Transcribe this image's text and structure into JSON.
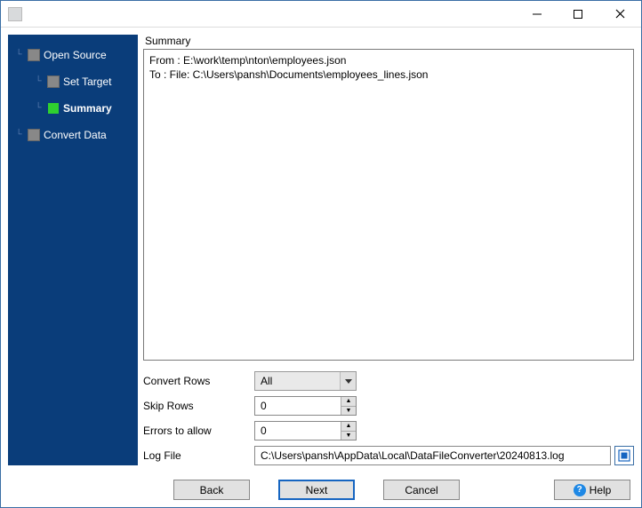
{
  "sidebar": {
    "items": [
      {
        "label": "Open Source",
        "active": false,
        "indent": 0
      },
      {
        "label": "Set Target",
        "active": false,
        "indent": 1
      },
      {
        "label": "Summary",
        "active": true,
        "indent": 1
      },
      {
        "label": "Convert Data",
        "active": false,
        "indent": 0
      }
    ]
  },
  "summary": {
    "heading": "Summary",
    "from_line": "From : E:\\work\\temp\\nton\\employees.json",
    "to_line": "To : File: C:\\Users\\pansh\\Documents\\employees_lines.json"
  },
  "form": {
    "convert_rows_label": "Convert Rows",
    "convert_rows_value": "All",
    "skip_rows_label": "Skip Rows",
    "skip_rows_value": "0",
    "errors_label": "Errors to allow",
    "errors_value": "0",
    "log_file_label": "Log File",
    "log_file_value": "C:\\Users\\pansh\\AppData\\Local\\DataFileConverter\\20240813.log"
  },
  "buttons": {
    "back": "Back",
    "next": "Next",
    "cancel": "Cancel",
    "help": "Help"
  }
}
